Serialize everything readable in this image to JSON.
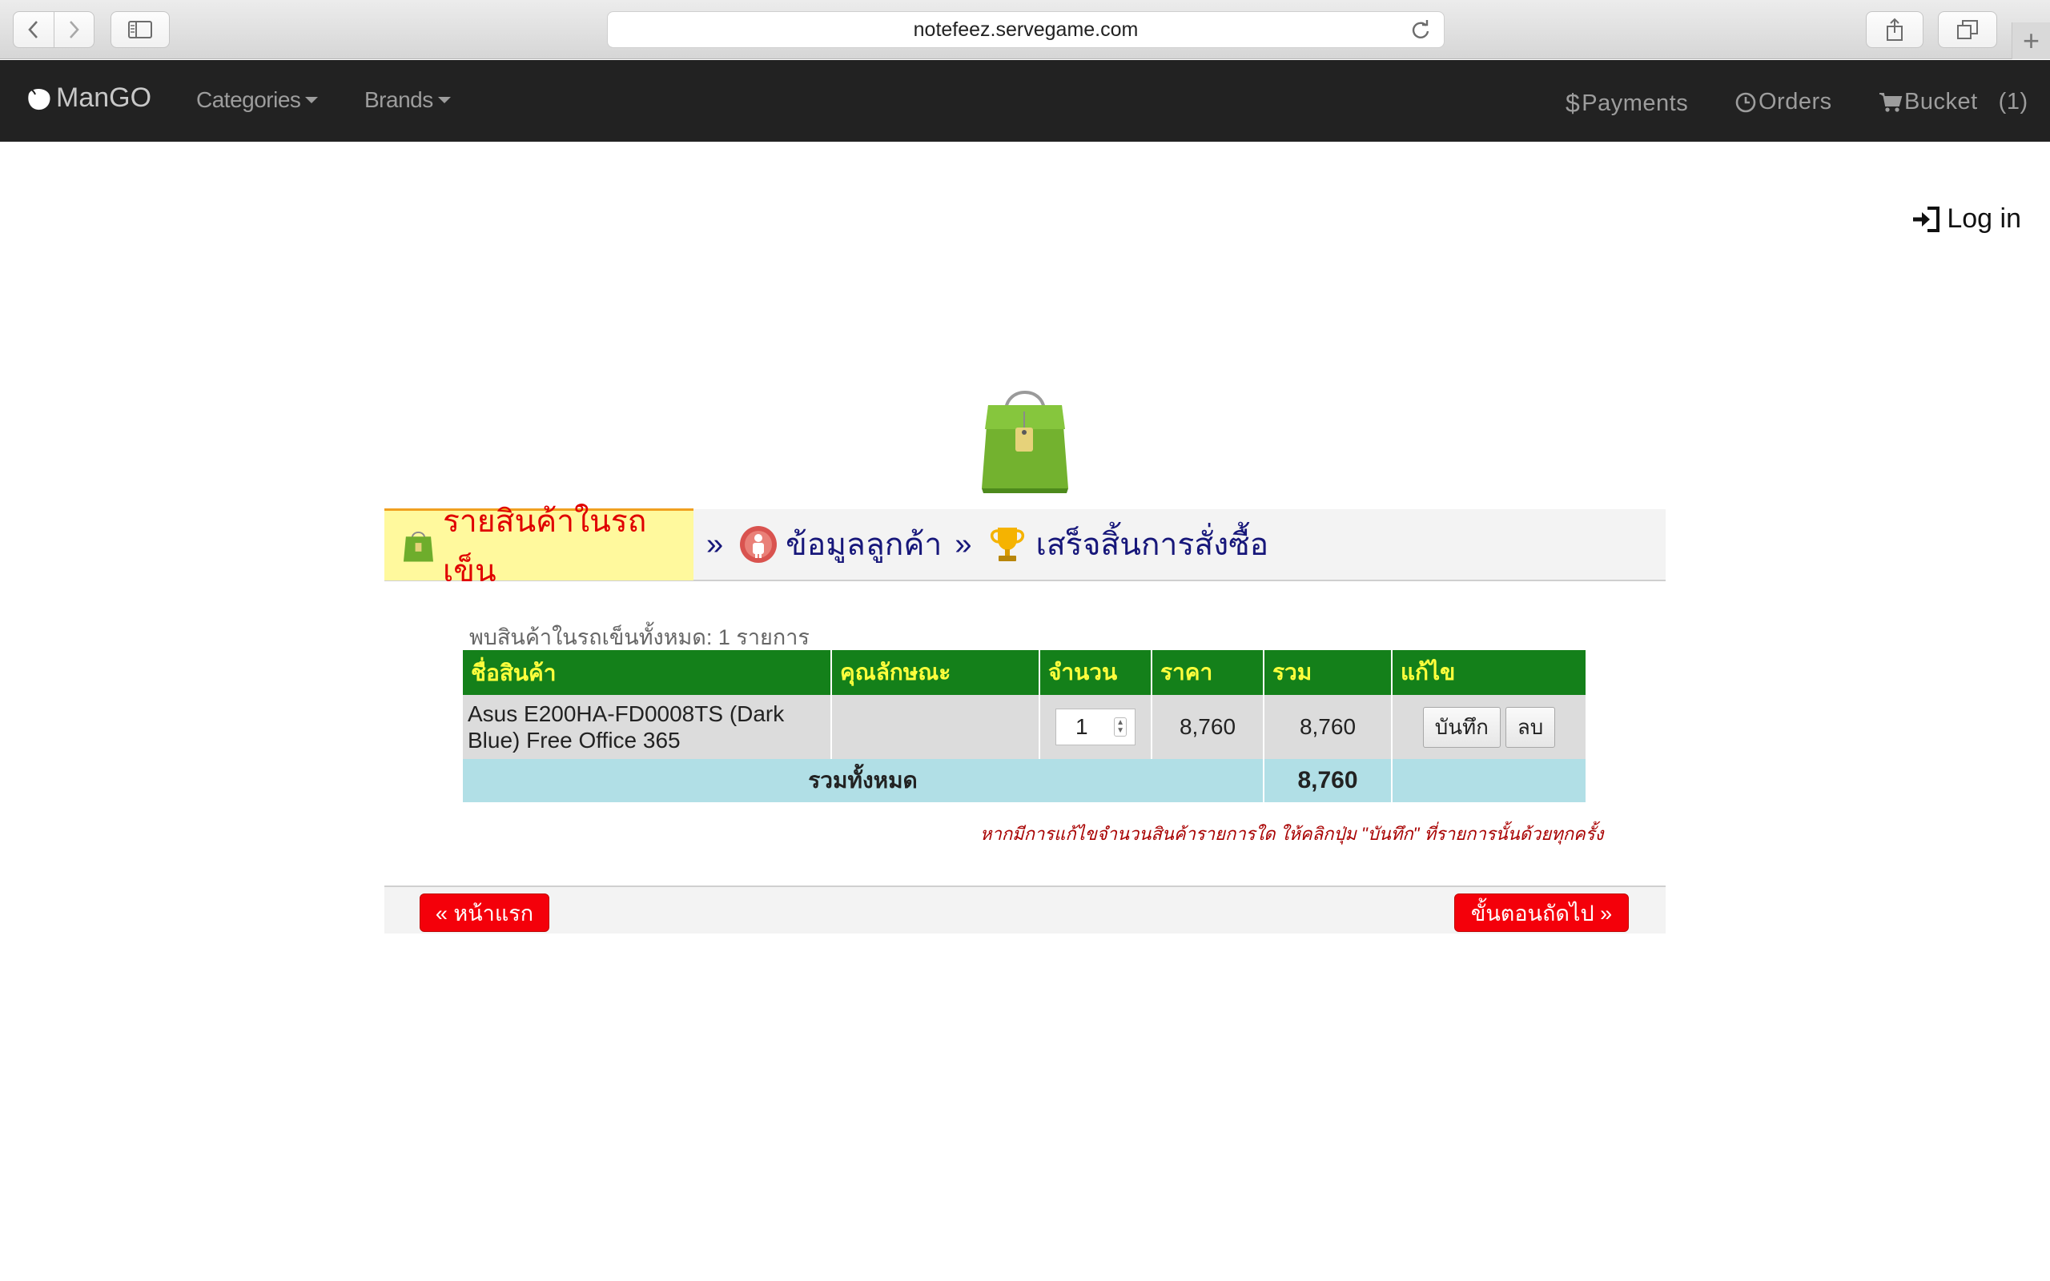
{
  "browser": {
    "url": "notefeez.servegame.com"
  },
  "navbar": {
    "brand": "ManGO",
    "categories": "Categories",
    "brands": "Brands",
    "payments": "Payments",
    "orders": "Orders",
    "bucket": "Bucket",
    "bucket_count": "(1)",
    "payments_symbol": "$"
  },
  "login": {
    "label": "Log in"
  },
  "steps": {
    "step1": "รายสินค้าในรถเข็น",
    "step2": "ข้อมูลลูกค้า",
    "step3": "เสร็จสิ้นการสั่งซื้อ",
    "separator": "»"
  },
  "cart": {
    "found_text": "พบสินค้าในรถเข็นทั้งหมด: 1 รายการ",
    "headers": {
      "name": "ชื่อสินค้า",
      "attributes": "คุณลักษณะ",
      "quantity": "จำนวน",
      "price": "ราคา",
      "sum": "รวม",
      "edit": "แก้ไข"
    },
    "items": [
      {
        "name": "Asus E200HA-FD0008TS (Dark Blue) Free Office 365",
        "attributes": "",
        "quantity": "1",
        "price": "8,760",
        "sum": "8,760",
        "save_label": "บันทึก",
        "delete_label": "ลบ"
      }
    ],
    "total_label": "รวมทั้งหมด",
    "total_value": "8,760",
    "note": "หากมีการแก้ไขจำนวนสินค้ารายการใด ให้คลิกปุ่ม \"บันทึก\" ที่รายการนั้นด้วยทุกครั้ง"
  },
  "footer": {
    "prev": "« หน้าแรก",
    "next": "ขั้นตอนถัดไป »"
  },
  "colors": {
    "navbar_bg": "#222222",
    "table_header_bg": "#14801a",
    "table_header_text": "#ffff3c",
    "total_row_bg": "#b1dfe6",
    "button_red": "#f4000a",
    "active_step_bg": "#fff99d",
    "active_step_text": "#e00000",
    "step_text": "#17177a"
  }
}
